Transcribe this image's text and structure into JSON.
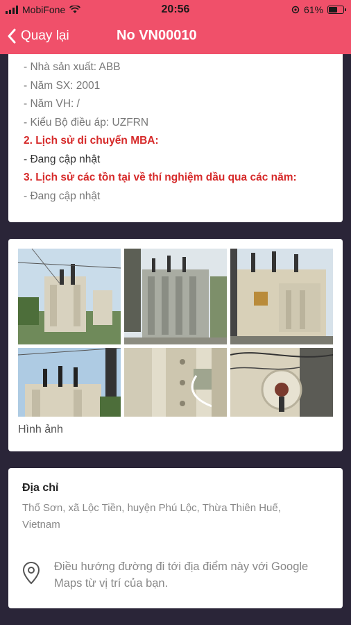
{
  "status_bar": {
    "carrier": "MobiFone",
    "time": "20:56",
    "battery": "61%",
    "battery_level": 0.61
  },
  "nav": {
    "back_label": "Quay lại",
    "title": "No VN00010"
  },
  "info": {
    "lines": [
      {
        "text": "- Nhà sản xuất: ABB",
        "style": "muted"
      },
      {
        "text": "- Năm SX: 2001",
        "style": "muted"
      },
      {
        "text": "- Năm VH: /",
        "style": "muted"
      },
      {
        "text": "- Kiểu Bộ điều áp: UZFRN",
        "style": "muted"
      }
    ],
    "heading_2": "2. Lịch sử di chuyển MBA:",
    "status_2": "- Đang cập nhật",
    "heading_3": "3. Lịch sử các tồn tại về thí nghiệm dầu qua các năm:",
    "status_3": "- Đang cập nhật"
  },
  "photos": {
    "caption": "Hình ảnh",
    "items": [
      {
        "name": "photo-1"
      },
      {
        "name": "photo-2"
      },
      {
        "name": "photo-3"
      },
      {
        "name": "photo-4"
      },
      {
        "name": "photo-5"
      },
      {
        "name": "photo-6"
      }
    ]
  },
  "address": {
    "title": "Địa chỉ",
    "text": "Thổ Sơn, xã Lộc Tiền, huyện Phú Lộc, Thừa Thiên Huế, Vietnam",
    "directions": "Điều hướng đường đi tới địa điểm này với Google Maps từ vị trí của bạn.",
    "icon": "map-pin-icon"
  },
  "colors": {
    "accent": "#f0506a",
    "background": "#2a2538",
    "heading_red": "#d62a2a"
  }
}
